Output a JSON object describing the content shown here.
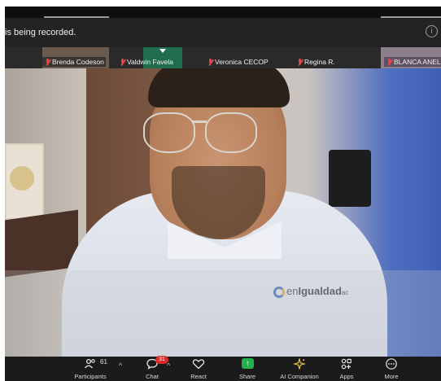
{
  "banner": {
    "recording_text": "is being recorded.",
    "info_glyph": "i"
  },
  "participants": [
    {
      "name": "Brenda Codeson",
      "muted": true
    },
    {
      "name": "Valdwin Favela",
      "muted": true
    },
    {
      "name": "Veronica CECOP",
      "muted": true
    },
    {
      "name": "Regina R.",
      "muted": true
    },
    {
      "name": "BLANCA ANEL",
      "muted": true
    }
  ],
  "video": {
    "shirt_logo_prefix": "en",
    "shirt_logo_bold": "Igualdad",
    "shirt_logo_suffix": "ac"
  },
  "toolbar": {
    "participants": {
      "label": "Participants",
      "count": "61",
      "icon": "participants-icon"
    },
    "chat": {
      "label": "Chat",
      "badge": "31",
      "icon": "chat-icon"
    },
    "react": {
      "label": "React",
      "icon": "heart-icon"
    },
    "share": {
      "label": "Share",
      "icon": "share-arrow-icon"
    },
    "ai_companion": {
      "label": "AI Companion",
      "icon": "sparkle-icon"
    },
    "apps": {
      "label": "Apps",
      "icon": "apps-icon"
    },
    "more": {
      "label": "More",
      "icon": "more-dots-icon"
    },
    "caret": "^"
  },
  "colors": {
    "toolbar_bg": "#1b1b1b",
    "share_green": "#23b14d",
    "mute_red": "#e84545",
    "badge_red": "#e02828"
  }
}
